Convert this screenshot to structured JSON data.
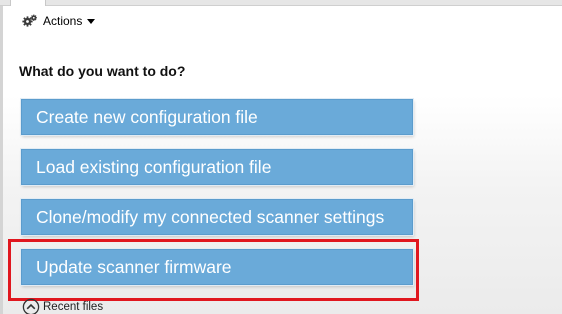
{
  "toolbar": {
    "actions_label": "Actions",
    "actions_icon": "gears-icon"
  },
  "main": {
    "prompt": "What do you want to do?",
    "options": [
      {
        "label": "Create new configuration file"
      },
      {
        "label": "Load existing configuration file"
      },
      {
        "label": "Clone/modify my connected scanner settings"
      },
      {
        "label": "Update scanner firmware"
      }
    ],
    "highlighted_option": "Update scanner firmware",
    "recent_label": "Recent files",
    "recent_icon": "chevron-up-circle-icon"
  },
  "colors": {
    "button_fill": "#6aaad9",
    "button_text": "#ffffff",
    "highlight_border": "#e0171f"
  }
}
